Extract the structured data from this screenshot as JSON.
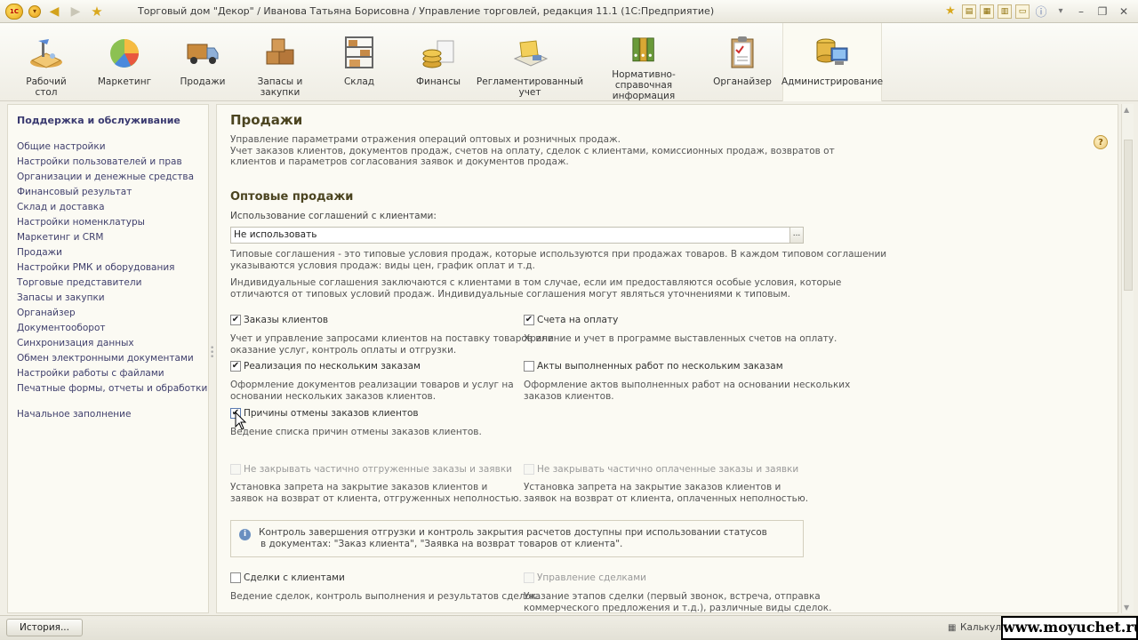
{
  "titlebar": {
    "title": "Торговый дом \"Декор\" / Иванова Татьяна Борисовна / Управление торговлей, редакция 11.1  (1С:Предприятие)",
    "logo": "1С",
    "window_buttons": [
      "–",
      "❐",
      "✕"
    ]
  },
  "sections": [
    {
      "label": "Рабочий\nстол",
      "icon": "desk-icon"
    },
    {
      "label": "Маркетинг",
      "icon": "pie-chart-icon"
    },
    {
      "label": "Продажи",
      "icon": "truck-icon"
    },
    {
      "label": "Запасы и\nзакупки",
      "icon": "boxes-icon"
    },
    {
      "label": "Склад",
      "icon": "shelf-icon"
    },
    {
      "label": "Финансы",
      "icon": "coins-icon"
    },
    {
      "label": "Регламентированный\nучет",
      "icon": "ledger-icon"
    },
    {
      "label": "Нормативно-справочная\nинформация",
      "icon": "binders-icon"
    },
    {
      "label": "Органайзер",
      "icon": "clipboard-icon"
    },
    {
      "label": "Администрирование",
      "icon": "computer-icon",
      "active": true
    }
  ],
  "sidebar": {
    "title": "Поддержка и обслуживание",
    "items": [
      "Общие настройки",
      "Настройки пользователей и прав",
      "Организации и денежные средства",
      "Финансовый результат",
      "Склад и доставка",
      "Настройки номенклатуры",
      "Маркетинг и CRM",
      "Продажи",
      "Настройки РМК и оборудования",
      "Торговые представители",
      "Запасы и закупки",
      "Органайзер",
      "Документооборот",
      "Синхронизация данных",
      "Обмен электронными документами",
      "Настройки работы с файлами",
      "Печатные формы, отчеты и обработки"
    ],
    "extra_item": "Начальное заполнение"
  },
  "content": {
    "title": "Продажи",
    "help": "?",
    "desc_lines": [
      "Управление параметрами отражения операций оптовых и розничных продаж.",
      "Учет заказов клиентов, документов продаж, счетов на оплату, сделок с клиентами, комиссионных продаж, возвратов от",
      "клиентов и параметров согласования заявок и документов продаж."
    ],
    "wholesale_heading": "Оптовые продажи",
    "agreements_label": "Использование соглашений с клиентами:",
    "agreements_value": "Не использовать",
    "agreements_button": "...",
    "typical_lines": [
      "Типовые соглашения - это типовые условия продаж, которые используются при продажах товаров. В каждом типовом соглашении",
      "указываются условия продаж: виды цен, график оплат и т.д."
    ],
    "individual_lines": [
      "Индивидуальные соглашения заключаются с клиентами в том случае, если им предоставляются особые условия, которые",
      "отличаются от типовых условий продаж. Индивидуальные соглашения могут являться уточнениями к типовым."
    ],
    "options": [
      {
        "label": "Заказы клиентов",
        "checked": true,
        "disabled": false,
        "desc": [
          "Учет и управление запросами клиентов на поставку товаров или",
          "оказание услуг, контроль оплаты и отгрузки."
        ]
      },
      {
        "label": "Счета на оплату",
        "checked": true,
        "disabled": false,
        "desc": [
          "Хранение и учет в программе выставленных счетов на оплату."
        ]
      },
      {
        "label": "Реализация по нескольким заказам",
        "checked": true,
        "disabled": false,
        "desc": [
          "Оформление документов реализации товаров и услуг на",
          "основании нескольких заказов клиентов."
        ]
      },
      {
        "label": "Акты выполненных работ по нескольким заказам",
        "checked": false,
        "disabled": false,
        "desc": [
          "Оформление актов выполненных работ на основании нескольких",
          "заказов клиентов."
        ]
      },
      {
        "label": "Причины отмены заказов клиентов",
        "checked": true,
        "disabled": false,
        "desc": [
          "Ведение списка причин отмены заказов клиентов."
        ]
      },
      {
        "label": "Не закрывать частично отгруженные заказы и заявки",
        "checked": false,
        "disabled": true,
        "desc": [
          "Установка запрета на закрытие заказов клиентов и",
          "заявок на возврат от клиента, отгруженных неполностью."
        ]
      },
      {
        "label": "Не закрывать частично оплаченные заказы и заявки",
        "checked": false,
        "disabled": true,
        "desc": [
          "Установка запрета на закрытие заказов клиентов и",
          "заявок на возврат от клиента, оплаченных неполностью."
        ]
      },
      {
        "label": "Сделки с клиентами",
        "checked": false,
        "disabled": false,
        "desc": [
          "Ведение сделок, контроль выполнения и результатов сделок."
        ]
      },
      {
        "label": "Управление сделками",
        "checked": false,
        "disabled": true,
        "desc": [
          "Указание этапов сделки (первый звонок, встреча, отправка",
          "коммерческого предложения и т.д.), различные виды сделок."
        ]
      }
    ],
    "info_lines": [
      "Контроль завершения отгрузки и контроль закрытия расчетов доступны при использовании статусов",
      "в документах: \"Заказ клиента\", \"Заявка на возврат товаров от клиента\"."
    ]
  },
  "statusbar": {
    "history_button": "История...",
    "calc_label": "Калькулятор",
    "watermark": "www.moyuchet.ru"
  },
  "colors": {
    "background": "#f1efe6",
    "panel": "#fbfaf3",
    "heading": "#4b4420",
    "link": "#3f3f6c"
  }
}
